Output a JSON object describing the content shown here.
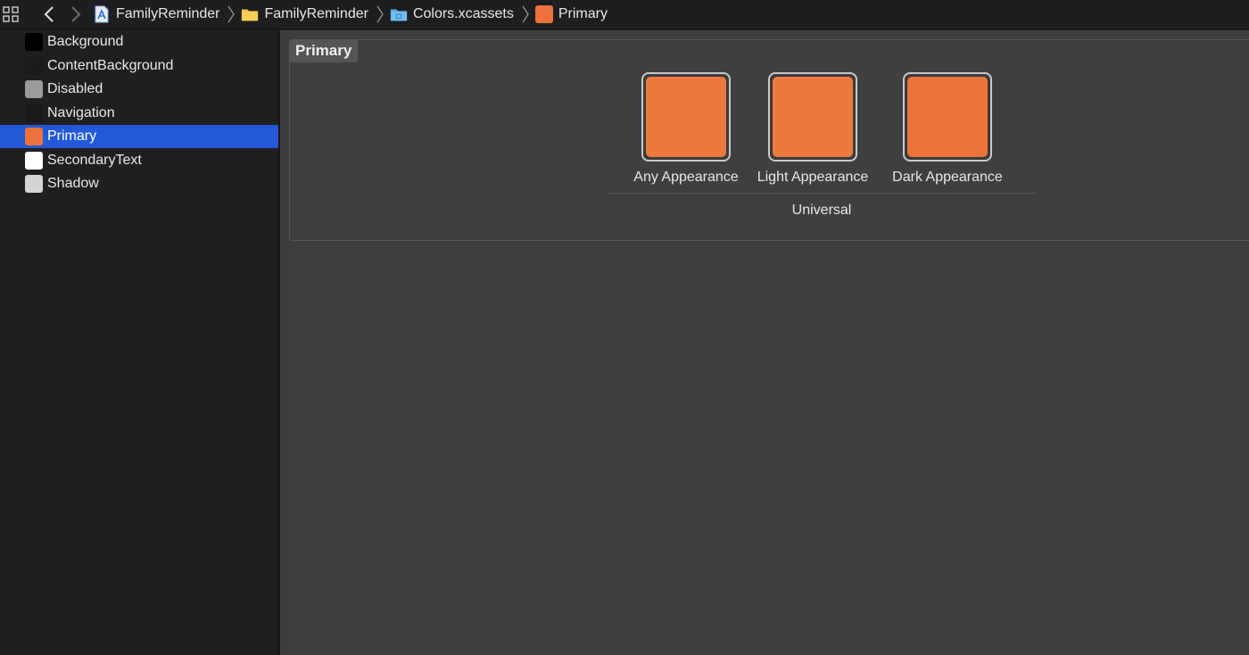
{
  "breadcrumbs": [
    {
      "label": "FamilyReminder",
      "icon": "project-file-icon"
    },
    {
      "label": "FamilyReminder",
      "icon": "folder-icon"
    },
    {
      "label": "Colors.xcassets",
      "icon": "asset-catalog-icon"
    },
    {
      "label": "Primary",
      "icon": "color-set-icon"
    }
  ],
  "sidebar": {
    "items": [
      {
        "label": "Background",
        "color": "#000000"
      },
      {
        "label": "ContentBackground",
        "color": "#1c1c1e"
      },
      {
        "label": "Disabled",
        "color": "#9b9b9b"
      },
      {
        "label": "Navigation",
        "color": "#1a1a1c"
      },
      {
        "label": "Primary",
        "color": "#ec733d",
        "selected": true
      },
      {
        "label": "SecondaryText",
        "color": "#ffffff"
      },
      {
        "label": "Shadow",
        "color": "#d4d4d4"
      }
    ]
  },
  "editor": {
    "title": "Primary",
    "appearances": [
      {
        "label": "Any Appearance",
        "color": "#ec7a3e"
      },
      {
        "label": "Light Appearance",
        "color": "#ec7a3e"
      },
      {
        "label": "Dark Appearance",
        "color": "#ec733a"
      }
    ],
    "group_label": "Universal"
  },
  "colors": {
    "selection": "#2358d6",
    "primary_orange": "#ec733d"
  }
}
